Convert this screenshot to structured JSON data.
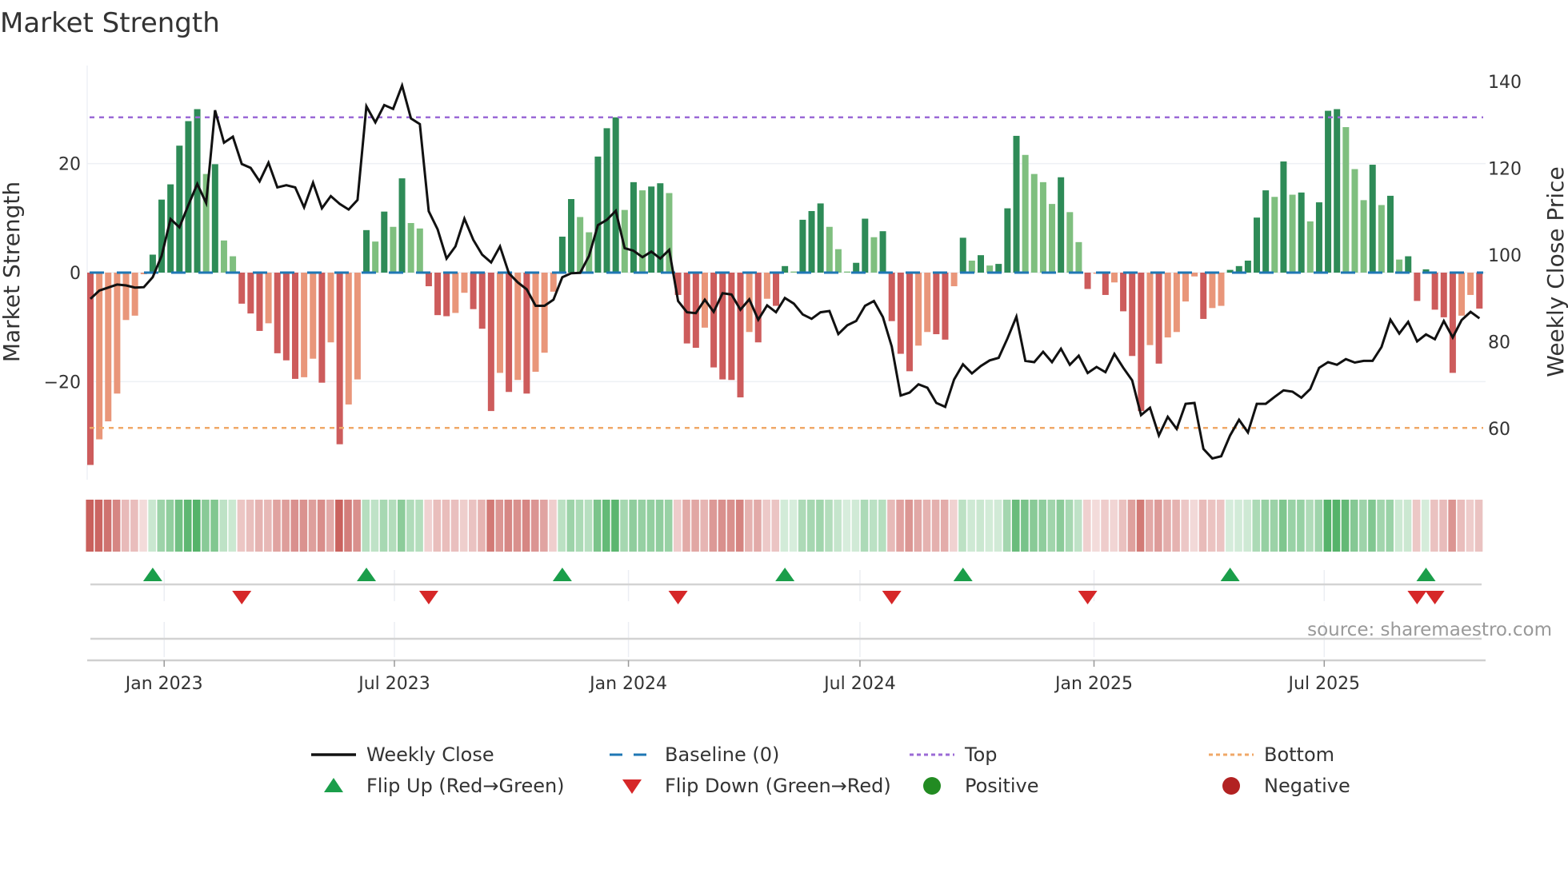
{
  "title": "Market Strength",
  "source": "source: sharemaestro.com",
  "chart_data": {
    "type": "bar",
    "overlay_type": "line",
    "title": "Market Strength",
    "start_date": "2022-11-04",
    "frequency": "weekly",
    "strength": [
      -35.3,
      -30.6,
      -27.3,
      -22.2,
      -8.7,
      -7.9,
      -0.3,
      3.3,
      13.4,
      16.2,
      23.3,
      27.8,
      30.0,
      18.1,
      19.9,
      5.9,
      3.0,
      -5.7,
      -7.5,
      -10.7,
      -9.3,
      -14.8,
      -16.1,
      -19.5,
      -19.2,
      -15.8,
      -20.2,
      -12.8,
      -31.5,
      -24.2,
      -19.6,
      7.8,
      5.7,
      11.2,
      8.4,
      17.3,
      9.1,
      8.1,
      -2.5,
      -7.8,
      -8.0,
      -7.4,
      -3.7,
      -6.7,
      -10.3,
      -25.4,
      -18.4,
      -21.9,
      -19.7,
      -22.2,
      -18.2,
      -14.7,
      -3.5,
      6.6,
      13.5,
      10.2,
      7.4,
      21.3,
      26.5,
      28.5,
      11.5,
      16.6,
      15.1,
      15.8,
      16.4,
      14.6,
      -4.1,
      -13.0,
      -13.8,
      -10.1,
      -17.4,
      -19.6,
      -19.7,
      -22.9,
      -10.9,
      -12.8,
      -4.8,
      -6.1,
      1.2,
      0.2,
      9.7,
      11.3,
      12.7,
      8.4,
      4.3,
      0.2,
      1.8,
      9.9,
      6.5,
      7.6,
      -8.9,
      -14.9,
      -18.1,
      -13.4,
      -10.9,
      -11.3,
      -12.3,
      -2.5,
      6.4,
      2.2,
      3.2,
      1.3,
      1.6,
      11.8,
      25.1,
      21.6,
      18.1,
      16.6,
      12.6,
      17.5,
      11.1,
      5.6,
      -3.0,
      -0.2,
      -4.1,
      -1.8,
      -7.1,
      -15.3,
      -25.4,
      -13.3,
      -16.7,
      -11.9,
      -10.9,
      -5.3,
      -0.7,
      -8.5,
      -6.5,
      -6.1,
      0.5,
      1.2,
      2.2,
      10.1,
      15.1,
      13.9,
      20.4,
      14.3,
      14.7,
      9.4,
      12.9,
      29.7,
      30.0,
      26.7,
      19.0,
      13.3,
      19.8,
      12.4,
      14.1,
      2.4,
      3.0,
      -5.2,
      0.6,
      -6.8,
      -8.2,
      -18.4,
      -7.9,
      -4.1,
      -6.6
    ],
    "weekly_close": [
      89.9,
      91.8,
      92.5,
      93.2,
      93.0,
      92.5,
      92.6,
      94.9,
      99.8,
      108.3,
      106.4,
      111.5,
      116.4,
      112.0,
      133.4,
      125.9,
      127.3,
      121.0,
      120.1,
      117.0,
      121.3,
      115.6,
      116.1,
      115.6,
      111.0,
      116.7,
      110.8,
      113.6,
      111.8,
      110.5,
      112.7,
      134.3,
      130.6,
      134.6,
      133.7,
      139.1,
      131.5,
      130.2,
      110.1,
      105.9,
      99.2,
      102.0,
      108.4,
      103.5,
      100.1,
      98.3,
      102.0,
      95.8,
      93.7,
      92.1,
      88.3,
      88.3,
      89.7,
      94.9,
      95.8,
      95.9,
      99.8,
      106.9,
      108.1,
      110.2,
      101.6,
      101.0,
      99.5,
      100.8,
      99.2,
      101.2,
      89.4,
      86.8,
      86.6,
      89.7,
      86.9,
      91.2,
      90.9,
      87.4,
      89.8,
      85.1,
      88.4,
      86.8,
      90.1,
      88.8,
      86.3,
      85.3,
      86.8,
      87.1,
      81.8,
      83.8,
      84.8,
      88.3,
      89.4,
      85.7,
      78.9,
      67.6,
      68.3,
      70.2,
      69.4,
      65.9,
      65.0,
      71.3,
      74.8,
      72.7,
      74.4,
      75.7,
      76.3,
      80.8,
      85.8,
      75.6,
      75.3,
      77.7,
      75.3,
      78.4,
      74.7,
      76.8,
      72.8,
      74.2,
      73.0,
      77.2,
      74.0,
      71.1,
      63.1,
      64.8,
      58.4,
      62.7,
      59.9,
      65.7,
      65.9,
      55.3,
      53.1,
      53.6,
      58.4,
      62.0,
      59.1,
      65.7,
      65.7,
      67.3,
      68.8,
      68.5,
      67.1,
      69.1,
      74.0,
      75.3,
      74.7,
      76.0,
      75.2,
      75.6,
      75.6,
      78.8,
      85.1,
      81.9,
      84.6,
      80.1,
      81.7,
      80.6,
      84.8,
      81.0,
      85.0,
      86.9,
      85.4
    ],
    "top": 28.5,
    "bottom": -28.5,
    "baseline": 0,
    "y_left": {
      "label": "Market Strength",
      "range": [
        -38,
        38
      ],
      "ticks": [
        {
          "value": 20,
          "label": "20"
        },
        {
          "value": 0,
          "label": "0"
        },
        {
          "value": -20,
          "label": "−20"
        }
      ]
    },
    "y_right": {
      "label": "Weekly Close Price",
      "range": [
        48.2,
        143.7
      ],
      "ticks": [
        {
          "value": 140,
          "label": "140"
        },
        {
          "value": 120,
          "label": "120"
        },
        {
          "value": 100,
          "label": "100"
        },
        {
          "value": 80,
          "label": "80"
        },
        {
          "value": 60,
          "label": "60"
        }
      ]
    },
    "x_ticks": [
      {
        "date": "2023-01-01",
        "label": "Jan 2023"
      },
      {
        "date": "2023-07-01",
        "label": "Jul 2023"
      },
      {
        "date": "2024-01-01",
        "label": "Jan 2024"
      },
      {
        "date": "2024-07-01",
        "label": "Jul 2024"
      },
      {
        "date": "2025-01-01",
        "label": "Jan 2025"
      },
      {
        "date": "2025-07-01",
        "label": "Jul 2025"
      }
    ],
    "flips": [
      {
        "index": 7,
        "dir": "up"
      },
      {
        "index": 17,
        "dir": "down"
      },
      {
        "index": 31,
        "dir": "up"
      },
      {
        "index": 38,
        "dir": "down"
      },
      {
        "index": 53,
        "dir": "up"
      },
      {
        "index": 66,
        "dir": "down"
      },
      {
        "index": 78,
        "dir": "up"
      },
      {
        "index": 90,
        "dir": "down"
      },
      {
        "index": 98,
        "dir": "up"
      },
      {
        "index": 112,
        "dir": "down"
      },
      {
        "index": 128,
        "dir": "up"
      },
      {
        "index": 149,
        "dir": "down"
      },
      {
        "index": 150,
        "dir": "up"
      },
      {
        "index": 151,
        "dir": "down"
      }
    ],
    "legend": [
      {
        "label": "Weekly Close",
        "symbol": "line",
        "color": "#111111"
      },
      {
        "label": "Baseline (0)",
        "symbol": "dash",
        "color": "#1f77b4"
      },
      {
        "label": "Top",
        "symbol": "dot",
        "color": "#9b6ad6"
      },
      {
        "label": "Bottom",
        "symbol": "dot",
        "color": "#f0a868"
      },
      {
        "label": "Flip Up (Red→Green)",
        "symbol": "triangle-up",
        "color": "#1a9e4a"
      },
      {
        "label": "Flip Down (Green→Red)",
        "symbol": "triangle-down",
        "color": "#d62728"
      },
      {
        "label": "Positive",
        "symbol": "circle",
        "color": "#228b22"
      },
      {
        "label": "Negative",
        "symbol": "circle",
        "color": "#b22222"
      }
    ],
    "colors": {
      "pos_strong": "#2e8b57",
      "pos_weak": "#7fbf7f",
      "neg_strong": "#cd5c5c",
      "neg_weak": "#e9967a",
      "strip_pos": "#4caf62",
      "strip_neg": "#c9605c",
      "line": "#111111"
    }
  }
}
